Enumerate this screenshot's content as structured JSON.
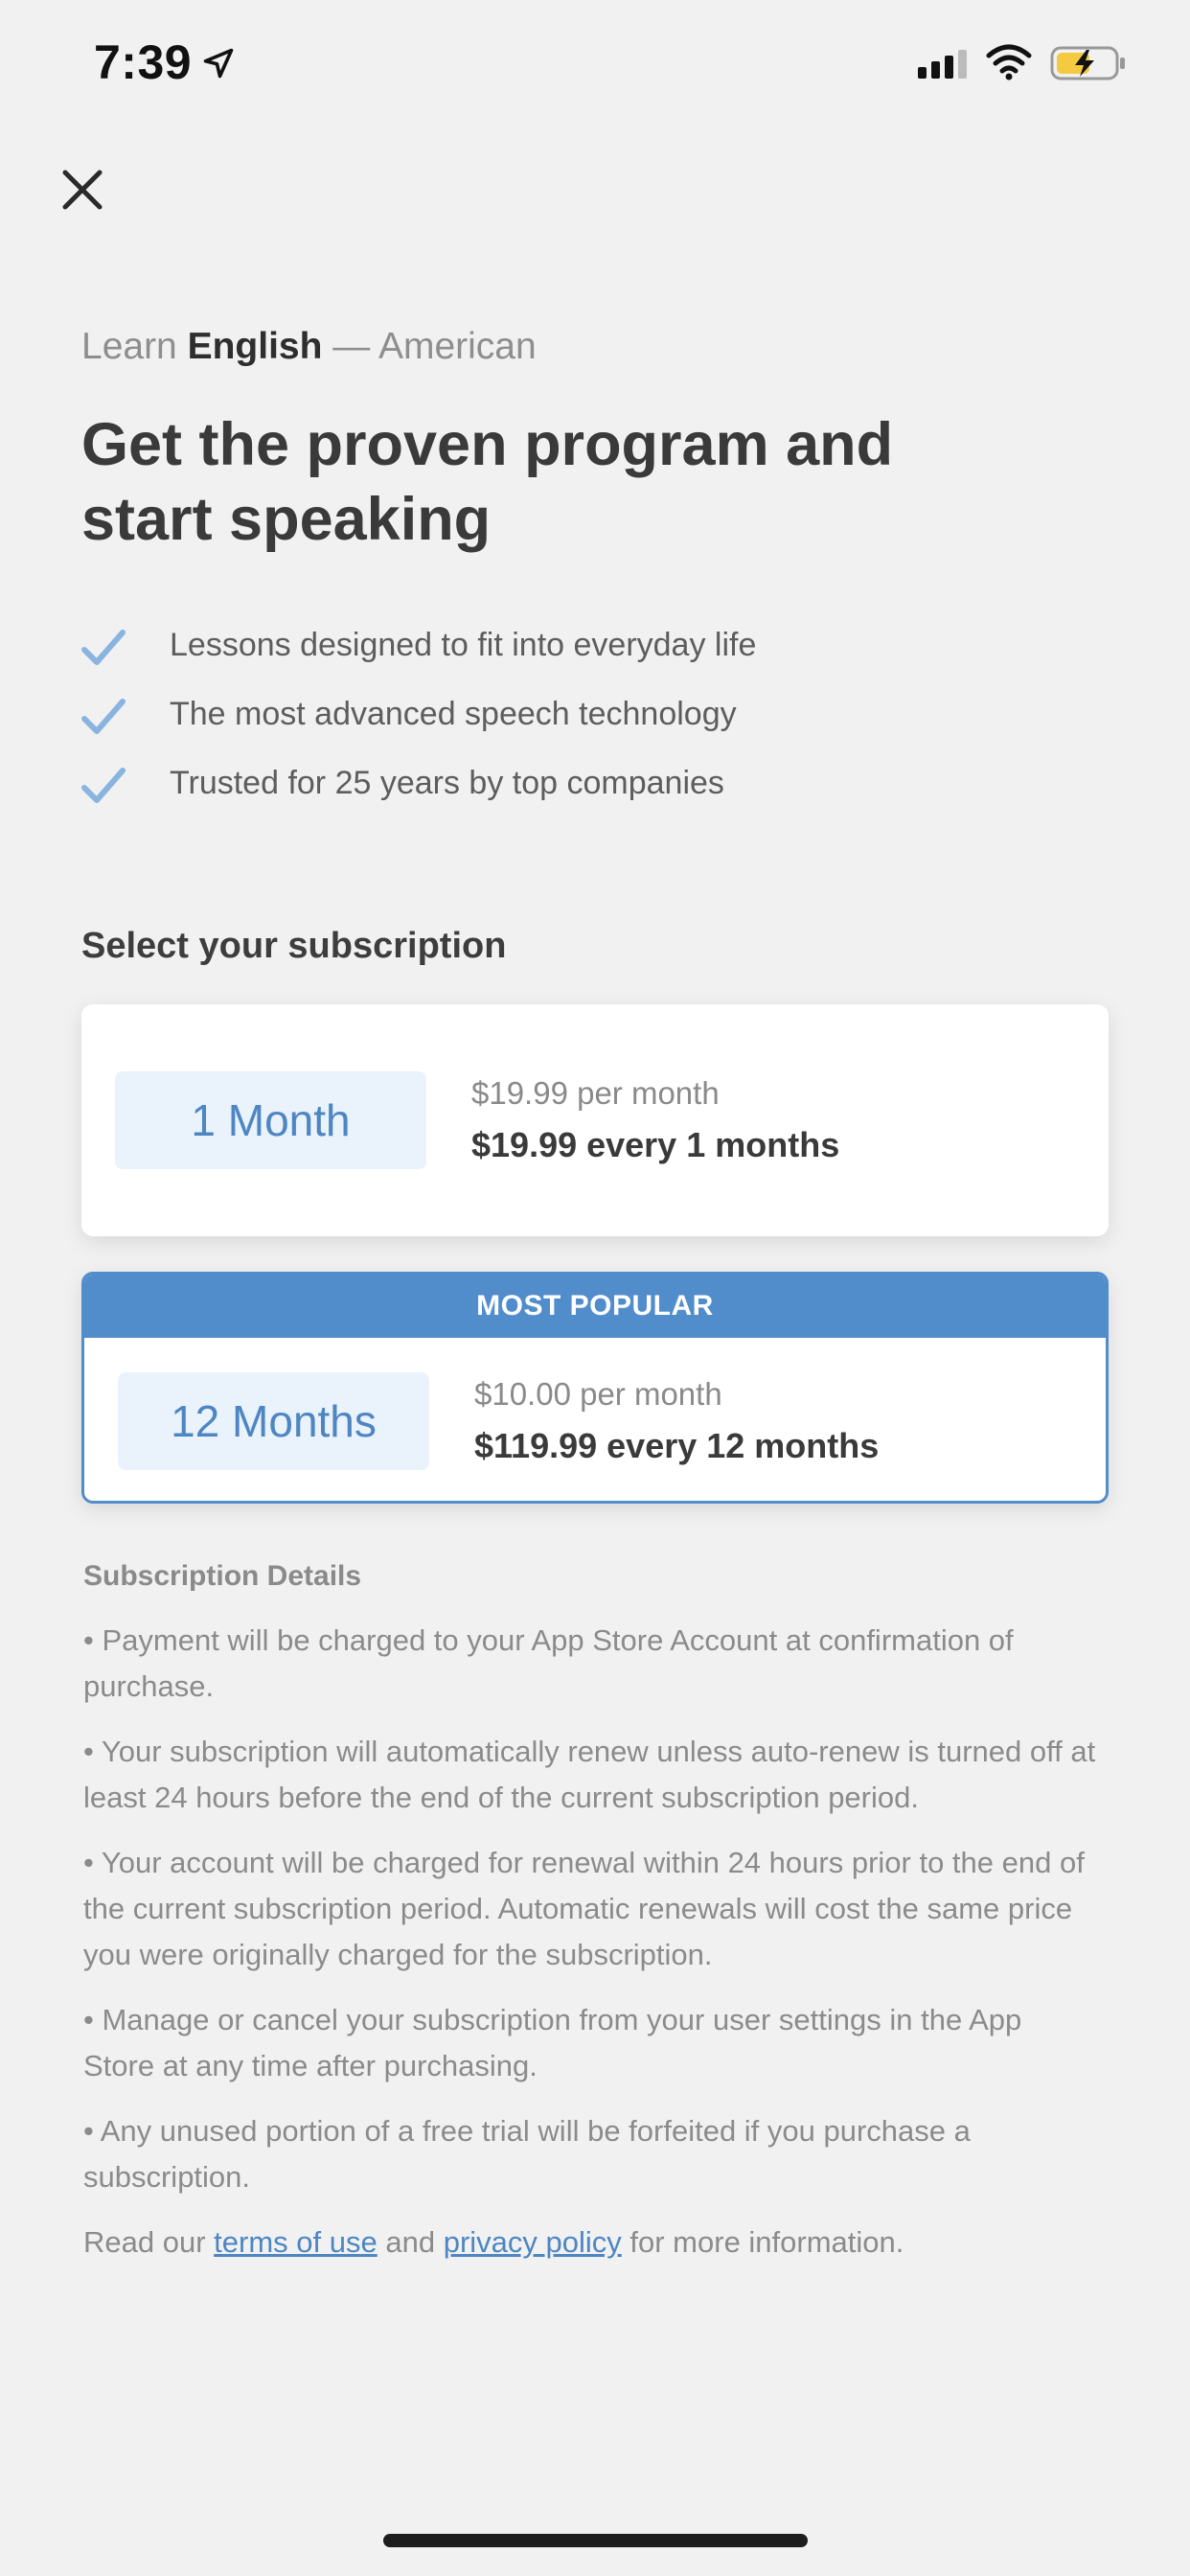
{
  "status_bar": {
    "time": "7:39"
  },
  "header": {
    "eyebrow_prefix": "Learn",
    "eyebrow_language": "English",
    "eyebrow_suffix": "— American",
    "headline_line1": "Get the proven program and",
    "headline_line2": "start speaking"
  },
  "features": [
    "Lessons designed to fit into everyday life",
    "The most advanced speech technology",
    "Trusted for 25 years by top companies"
  ],
  "subscription": {
    "section_title": "Select your subscription",
    "plans": [
      {
        "duration": "1 Month",
        "price_per": "$19.99 per month",
        "price_total": "$19.99 every 1 months"
      },
      {
        "badge": "MOST POPULAR",
        "duration": "12 Months",
        "price_per": "$10.00 per month",
        "price_total": "$119.99 every 12 months"
      }
    ]
  },
  "details": {
    "title": "Subscription Details",
    "items": [
      "•  Payment will be charged to your App Store Account at confirmation of purchase.",
      "•  Your subscription will automatically renew unless auto-renew is turned off at least 24 hours before the end of the current subscription period.",
      "• Your account will be charged for renewal within 24 hours prior to the end of the current subscription period. Automatic renewals will cost the same price you were originally charged for the subscription.",
      "• Manage or cancel your subscription from your user settings in the App Store at any time after purchasing.",
      "• Any unused portion of a free trial will be forfeited if you purchase a subscription."
    ],
    "footer_prefix": "Read our",
    "terms_link": "terms of use",
    "footer_and": "and",
    "privacy_link": "privacy policy",
    "footer_suffix": "for more information."
  },
  "colors": {
    "accent": "#518dcb",
    "pill_bg": "#eaf2fb",
    "background": "#f1f1f1",
    "check": "#8ab4e0"
  }
}
